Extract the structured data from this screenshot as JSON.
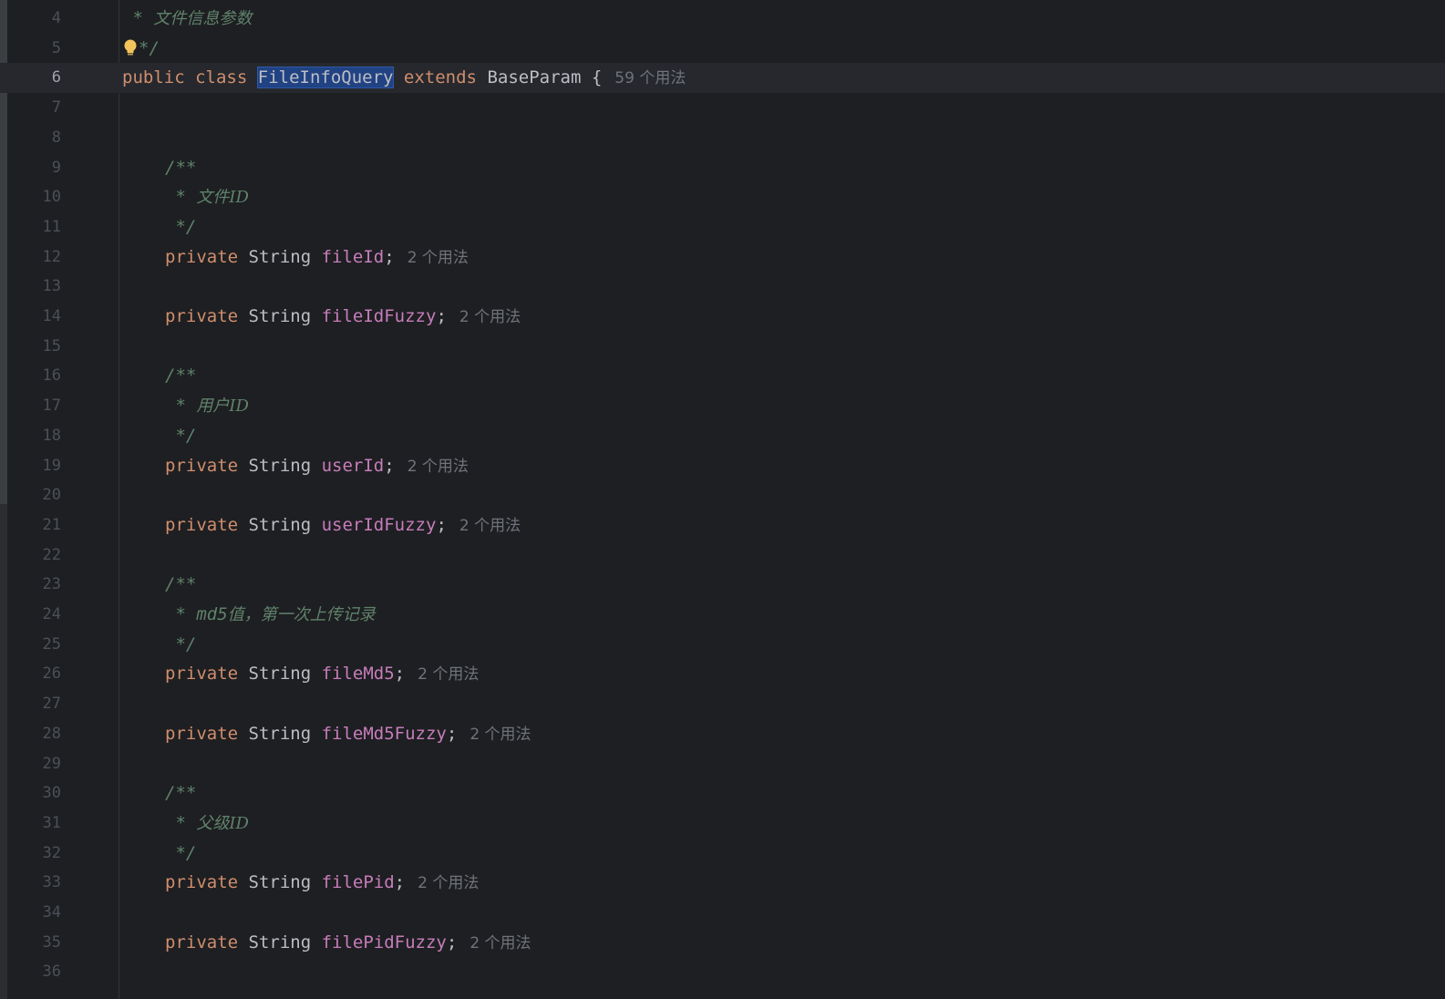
{
  "editor": {
    "lines": [
      {
        "n": "4",
        "indent": "",
        "tokens": [
          {
            "t": " * ",
            "c": "cmt"
          },
          {
            "t": "文件信息参数",
            "c": "cmt-cjk"
          }
        ]
      },
      {
        "n": "5",
        "indent": "",
        "bulb": true,
        "tokens": [
          {
            "t": "*/",
            "c": "cmt"
          }
        ]
      },
      {
        "n": "6",
        "current": true,
        "indent": "",
        "tokens": [
          {
            "t": "public",
            "c": "kw"
          },
          {
            "t": " ",
            "c": "punc"
          },
          {
            "t": "class",
            "c": "kw"
          },
          {
            "t": " ",
            "c": "punc"
          },
          {
            "t": "FileInfoQuery",
            "c": "sel"
          },
          {
            "t": " ",
            "c": "punc"
          },
          {
            "t": "extends",
            "c": "kw"
          },
          {
            "t": " BaseParam {",
            "c": "type"
          }
        ],
        "hint": "59 个用法"
      },
      {
        "n": "7",
        "tokens": []
      },
      {
        "n": "8",
        "tokens": []
      },
      {
        "n": "9",
        "indent": "    ",
        "tokens": [
          {
            "t": "/**",
            "c": "cmt"
          }
        ]
      },
      {
        "n": "10",
        "indent": "    ",
        "tokens": [
          {
            "t": " * ",
            "c": "cmt"
          },
          {
            "t": "文件ID",
            "c": "cmt-cjk"
          }
        ]
      },
      {
        "n": "11",
        "indent": "    ",
        "tokens": [
          {
            "t": " */",
            "c": "cmt"
          }
        ]
      },
      {
        "n": "12",
        "indent": "    ",
        "tokens": [
          {
            "t": "private",
            "c": "kw"
          },
          {
            "t": " String ",
            "c": "type"
          },
          {
            "t": "fileId",
            "c": "field"
          },
          {
            "t": ";",
            "c": "punc"
          }
        ],
        "hint": "2 个用法"
      },
      {
        "n": "13",
        "tokens": []
      },
      {
        "n": "14",
        "indent": "    ",
        "tokens": [
          {
            "t": "private",
            "c": "kw"
          },
          {
            "t": " String ",
            "c": "type"
          },
          {
            "t": "fileIdFuzzy",
            "c": "field"
          },
          {
            "t": ";",
            "c": "punc"
          }
        ],
        "hint": "2 个用法"
      },
      {
        "n": "15",
        "tokens": []
      },
      {
        "n": "16",
        "indent": "    ",
        "tokens": [
          {
            "t": "/**",
            "c": "cmt"
          }
        ]
      },
      {
        "n": "17",
        "indent": "    ",
        "tokens": [
          {
            "t": " * ",
            "c": "cmt"
          },
          {
            "t": "用户ID",
            "c": "cmt-cjk"
          }
        ]
      },
      {
        "n": "18",
        "indent": "    ",
        "tokens": [
          {
            "t": " */",
            "c": "cmt"
          }
        ]
      },
      {
        "n": "19",
        "indent": "    ",
        "tokens": [
          {
            "t": "private",
            "c": "kw"
          },
          {
            "t": " String ",
            "c": "type"
          },
          {
            "t": "userId",
            "c": "field"
          },
          {
            "t": ";",
            "c": "punc"
          }
        ],
        "hint": "2 个用法"
      },
      {
        "n": "20",
        "tokens": []
      },
      {
        "n": "21",
        "indent": "    ",
        "tokens": [
          {
            "t": "private",
            "c": "kw"
          },
          {
            "t": " String ",
            "c": "type"
          },
          {
            "t": "userIdFuzzy",
            "c": "field"
          },
          {
            "t": ";",
            "c": "punc"
          }
        ],
        "hint": "2 个用法"
      },
      {
        "n": "22",
        "tokens": []
      },
      {
        "n": "23",
        "indent": "    ",
        "tokens": [
          {
            "t": "/**",
            "c": "cmt"
          }
        ]
      },
      {
        "n": "24",
        "indent": "    ",
        "tokens": [
          {
            "t": " * md5",
            "c": "cmt"
          },
          {
            "t": "值，第一次上传记录",
            "c": "cmt-cjk"
          }
        ]
      },
      {
        "n": "25",
        "indent": "    ",
        "tokens": [
          {
            "t": " */",
            "c": "cmt"
          }
        ]
      },
      {
        "n": "26",
        "indent": "    ",
        "tokens": [
          {
            "t": "private",
            "c": "kw"
          },
          {
            "t": " String ",
            "c": "type"
          },
          {
            "t": "fileMd5",
            "c": "field"
          },
          {
            "t": ";",
            "c": "punc"
          }
        ],
        "hint": "2 个用法"
      },
      {
        "n": "27",
        "tokens": []
      },
      {
        "n": "28",
        "indent": "    ",
        "tokens": [
          {
            "t": "private",
            "c": "kw"
          },
          {
            "t": " String ",
            "c": "type"
          },
          {
            "t": "fileMd5Fuzzy",
            "c": "field"
          },
          {
            "t": ";",
            "c": "punc"
          }
        ],
        "hint": "2 个用法"
      },
      {
        "n": "29",
        "tokens": []
      },
      {
        "n": "30",
        "indent": "    ",
        "tokens": [
          {
            "t": "/**",
            "c": "cmt"
          }
        ]
      },
      {
        "n": "31",
        "indent": "    ",
        "tokens": [
          {
            "t": " * ",
            "c": "cmt"
          },
          {
            "t": "父级ID",
            "c": "cmt-cjk"
          }
        ]
      },
      {
        "n": "32",
        "indent": "    ",
        "tokens": [
          {
            "t": " */",
            "c": "cmt"
          }
        ]
      },
      {
        "n": "33",
        "indent": "    ",
        "tokens": [
          {
            "t": "private",
            "c": "kw"
          },
          {
            "t": " String ",
            "c": "type"
          },
          {
            "t": "filePid",
            "c": "field"
          },
          {
            "t": ";",
            "c": "punc"
          }
        ],
        "hint": "2 个用法"
      },
      {
        "n": "34",
        "tokens": []
      },
      {
        "n": "35",
        "indent": "    ",
        "tokens": [
          {
            "t": "private",
            "c": "kw"
          },
          {
            "t": " String ",
            "c": "type"
          },
          {
            "t": "filePidFuzzy",
            "c": "field"
          },
          {
            "t": ";",
            "c": "punc"
          }
        ],
        "hint": "2 个用法"
      },
      {
        "n": "36",
        "tokens": []
      }
    ],
    "colors": {
      "background": "#1e1f22",
      "keyword": "#cf8e6d",
      "field": "#c77dbb",
      "comment": "#5f826b",
      "selection": "#214283",
      "hint": "#6f737a"
    },
    "bulb_icon": "lightbulb-icon"
  }
}
